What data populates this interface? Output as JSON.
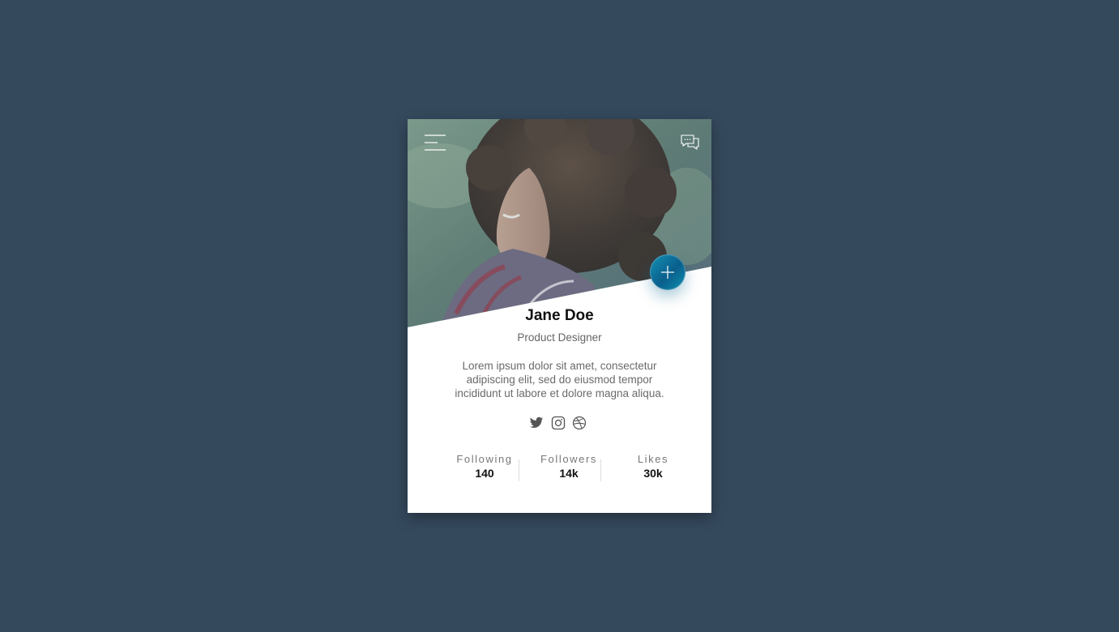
{
  "profile": {
    "name": "Jane Doe",
    "role": "Product Designer",
    "bio": "Lorem ipsum dolor sit amet, consectetur adipiscing elit, sed do eiusmod tempor incididunt ut labore et dolore magna aliqua."
  },
  "header": {
    "menu_icon": "hamburger-menu-icon",
    "chat_icon": "chat-bubbles-icon"
  },
  "action": {
    "icon": "plus-icon",
    "accent_color": "#0e7fa8"
  },
  "socials": [
    {
      "icon": "twitter-icon"
    },
    {
      "icon": "instagram-icon"
    },
    {
      "icon": "dribbble-icon"
    }
  ],
  "stats": [
    {
      "label": "Following",
      "value": "140"
    },
    {
      "label": "Followers",
      "value": "14k"
    },
    {
      "label": "Likes",
      "value": "30k"
    }
  ],
  "colors": {
    "page_background": "#35495d",
    "card_background": "#ffffff",
    "text_primary": "#111111",
    "text_secondary": "#666666"
  }
}
